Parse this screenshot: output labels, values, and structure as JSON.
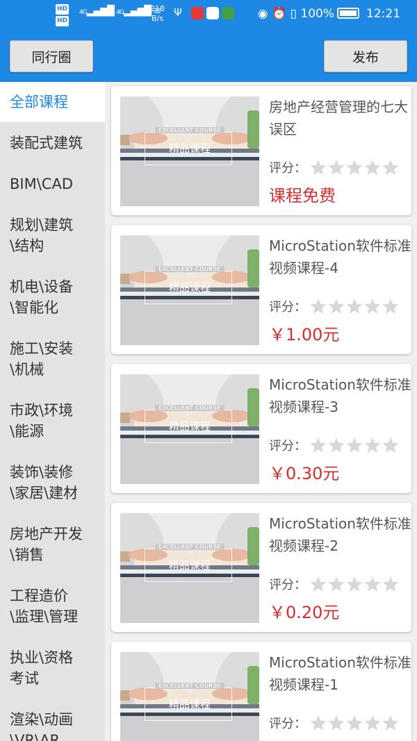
{
  "status_bar": {
    "hd1": "HD",
    "hd2": "HD",
    "sig1": "4G",
    "sig2": "4G",
    "speed_value": "218",
    "speed_unit": "B/s",
    "battery": "100%",
    "time": "12:21"
  },
  "header": {
    "left_button": "同行圈",
    "right_button": "发布"
  },
  "sidebar": {
    "items": [
      {
        "label": "全部课程"
      },
      {
        "label": "装配式建筑"
      },
      {
        "label": "BIM\\CAD"
      },
      {
        "label": "规划\\建筑\\结构"
      },
      {
        "label": "机电\\设备\\智能化"
      },
      {
        "label": "施工\\安装\\机械"
      },
      {
        "label": "市政\\环境\\能源"
      },
      {
        "label": "装饰\\装修\\家居\\建材"
      },
      {
        "label": "房地产开发\\销售"
      },
      {
        "label": "工程造价\\监理\\管理"
      },
      {
        "label": "执业\\资格考试"
      },
      {
        "label": "渲染\\动画\\VR\\AR"
      }
    ]
  },
  "courses": [
    {
      "title": "房地产经营管理的七大误区",
      "rating_label": "评分：",
      "rating": 0,
      "price": "课程免费",
      "thumb_en": "EXCELLENT COURSE",
      "thumb_cn": "精品课程"
    },
    {
      "title": "MicroStation软件标准视频课程-4",
      "rating_label": "评分：",
      "rating": 0,
      "price": "￥1.00元",
      "thumb_en": "EXCELLENT COURSE",
      "thumb_cn": "精品课程"
    },
    {
      "title": "MicroStation软件标准视频课程-3",
      "rating_label": "评分：",
      "rating": 0,
      "price": "￥0.30元",
      "thumb_en": "EXCELLENT COURSE",
      "thumb_cn": "精品课程"
    },
    {
      "title": "MicroStation软件标准视频课程-2",
      "rating_label": "评分：",
      "rating": 0,
      "price": "￥0.20元",
      "thumb_en": "EXCELLENT COURSE",
      "thumb_cn": "精品课程"
    },
    {
      "title": "MicroStation软件标准视频课程-1",
      "rating_label": "评分：",
      "rating": 0,
      "price": "",
      "thumb_en": "EXCELLENT COURSE",
      "thumb_cn": "精品课程"
    }
  ],
  "colors": {
    "primary": "#1e88e5",
    "price": "#d32f2f",
    "star_empty": "#d8d8d8"
  }
}
